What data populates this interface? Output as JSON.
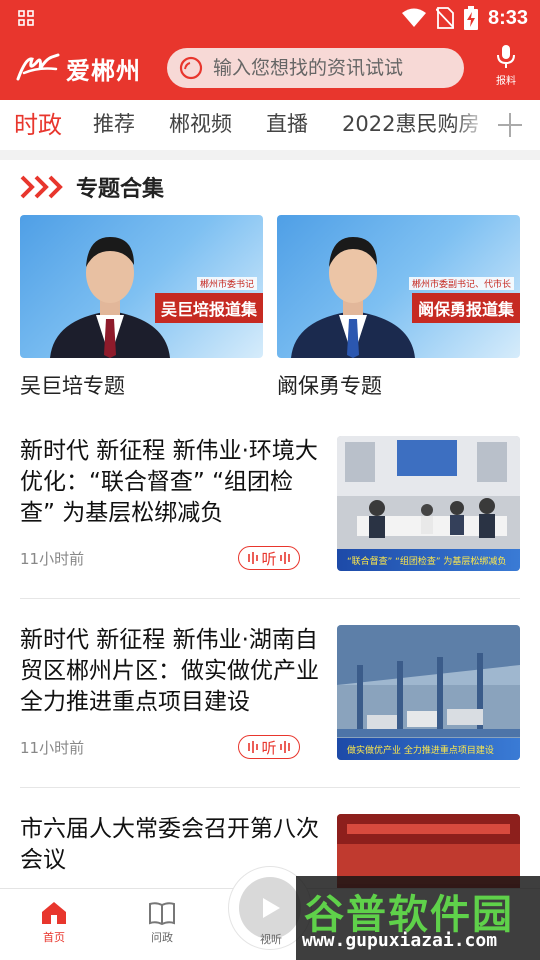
{
  "status_bar": {
    "time": "8:33"
  },
  "header": {
    "logo_text": "爱郴州",
    "search_placeholder": "输入您想找的资讯试试",
    "report_label": "报料"
  },
  "tabs": [
    "时政",
    "推荐",
    "郴视频",
    "直播",
    "2022惠民购房"
  ],
  "section": {
    "title": "专题合集"
  },
  "topics": [
    {
      "name": "吴巨培专题",
      "banner": "吴巨培报道集",
      "subtitle": "郴州市委书记"
    },
    {
      "name": "阚保勇专题",
      "banner": "阚保勇报道集",
      "subtitle": "郴州市委副书记、代市长"
    }
  ],
  "news": [
    {
      "title": "新时代 新征程 新伟业·环境大优化：“联合督查” “组团检查” 为基层松绑减负",
      "time": "11小时前",
      "listen": "听",
      "thumb_caption": "“联合督查” “组团检查” 为基层松绑减负"
    },
    {
      "title": "新时代 新征程 新伟业·湖南自贸区郴州片区：做实做优产业 全力推进重点项目建设",
      "time": "11小时前",
      "listen": "听",
      "thumb_caption": "做实做优产业 全力推进重点项目建设"
    },
    {
      "title": "市六届人大常委会召开第八次会议"
    }
  ],
  "bottom_nav": {
    "home": "首页",
    "ask": "问政",
    "watch": "视听"
  },
  "watermark": {
    "title": "谷普软件园",
    "url": "www.gupuxiazai.com"
  },
  "colors": {
    "brand_red": "#e8362d",
    "wm_green": "#5fd14a"
  }
}
